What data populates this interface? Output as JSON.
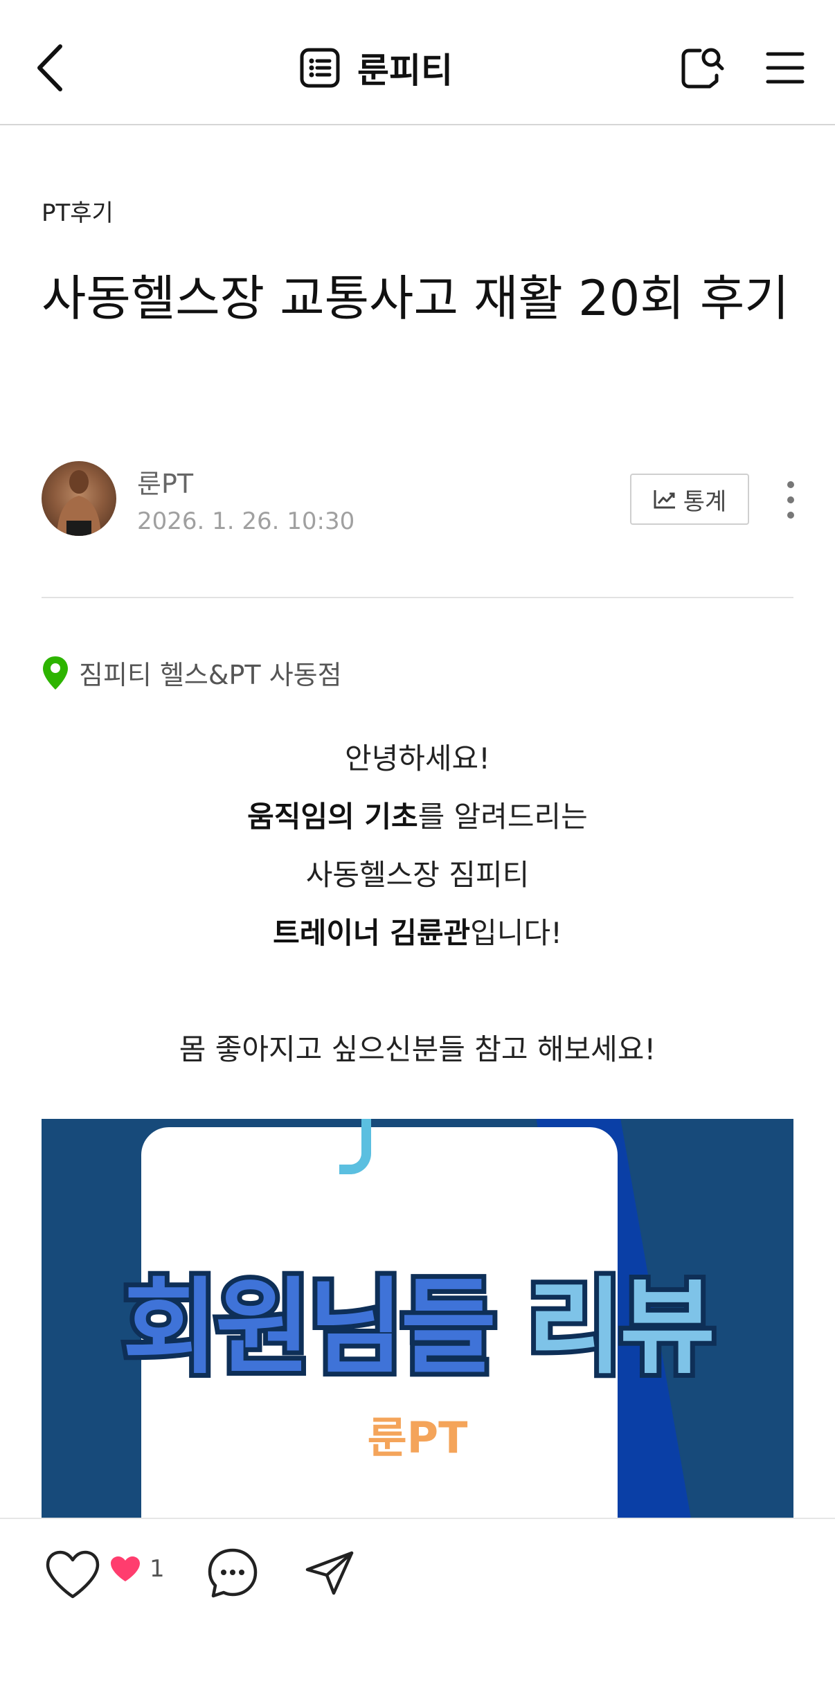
{
  "header": {
    "blog_name": "룬피티",
    "icons": [
      "back-arrow-icon",
      "list-icon",
      "search-icon",
      "menu-icon"
    ]
  },
  "post": {
    "category": "PT후기",
    "title": "사동헬스장 교통사고 재활 20회 후기",
    "author": "룬PT",
    "date": "2026. 1. 26. 10:30",
    "stats_label": "통계",
    "location": "짐피티 헬스&PT 사동점"
  },
  "body": {
    "line1": "안녕하세요!",
    "line2_bold": "움직임의 기초",
    "line2_rest": "를 알려드리는",
    "line3": "사동헬스장 짐피티",
    "line4_bold": "트레이너 김륜관",
    "line4_rest": "입니다!",
    "line5": "몸 좋아지고 싶으신분들 참고 해보세요!"
  },
  "image": {
    "title_part1": "회원님들",
    "title_part2": "리뷰",
    "subtitle": "룬PT"
  },
  "footer": {
    "like_count": "1"
  },
  "colors": {
    "accent_green": "#2db400",
    "heart_pink": "#ff3d6e",
    "image_bg": "#174a7a"
  }
}
